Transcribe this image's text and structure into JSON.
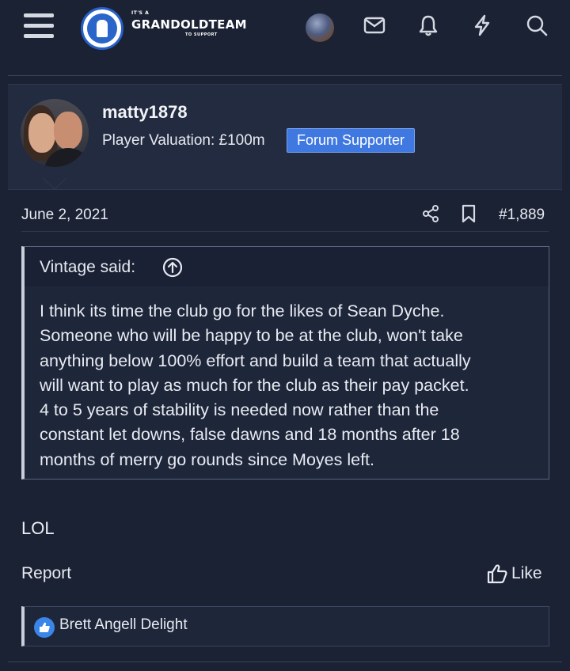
{
  "header": {
    "logo_small_top": "IT'S A",
    "logo_name": "GRANDOLDTEAM",
    "logo_small_bottom": "TO SUPPORT",
    "icons": [
      "menu-icon",
      "mail-icon",
      "bell-icon",
      "lightning-icon",
      "search-icon"
    ]
  },
  "user": {
    "name": "matty1878",
    "valuation": "Player Valuation: £100m",
    "badge": "Forum Supporter"
  },
  "post": {
    "date": "June 2, 2021",
    "number": "#1,889",
    "text": "LOL",
    "report_label": "Report",
    "like_label": "Like"
  },
  "quote": {
    "author": "Vintage said:",
    "lines": [
      "I think its time the club go for the likes of Sean Dyche.",
      "Someone who will be happy to be at the club, won't take",
      "anything below 100% effort and build a team that actually",
      "will want to play as much for the club as their pay packet.",
      "4 to 5 years of stability is needed now rather than the",
      "constant let downs, false dawns and 18 months after 18",
      "months of merry go rounds since Moyes left."
    ]
  },
  "reactions": {
    "names": "Brett Angell Delight"
  },
  "colors": {
    "background": "#1b2234",
    "panel": "#232b40",
    "badge": "#3f78e0",
    "reaction": "#3a86e8"
  }
}
